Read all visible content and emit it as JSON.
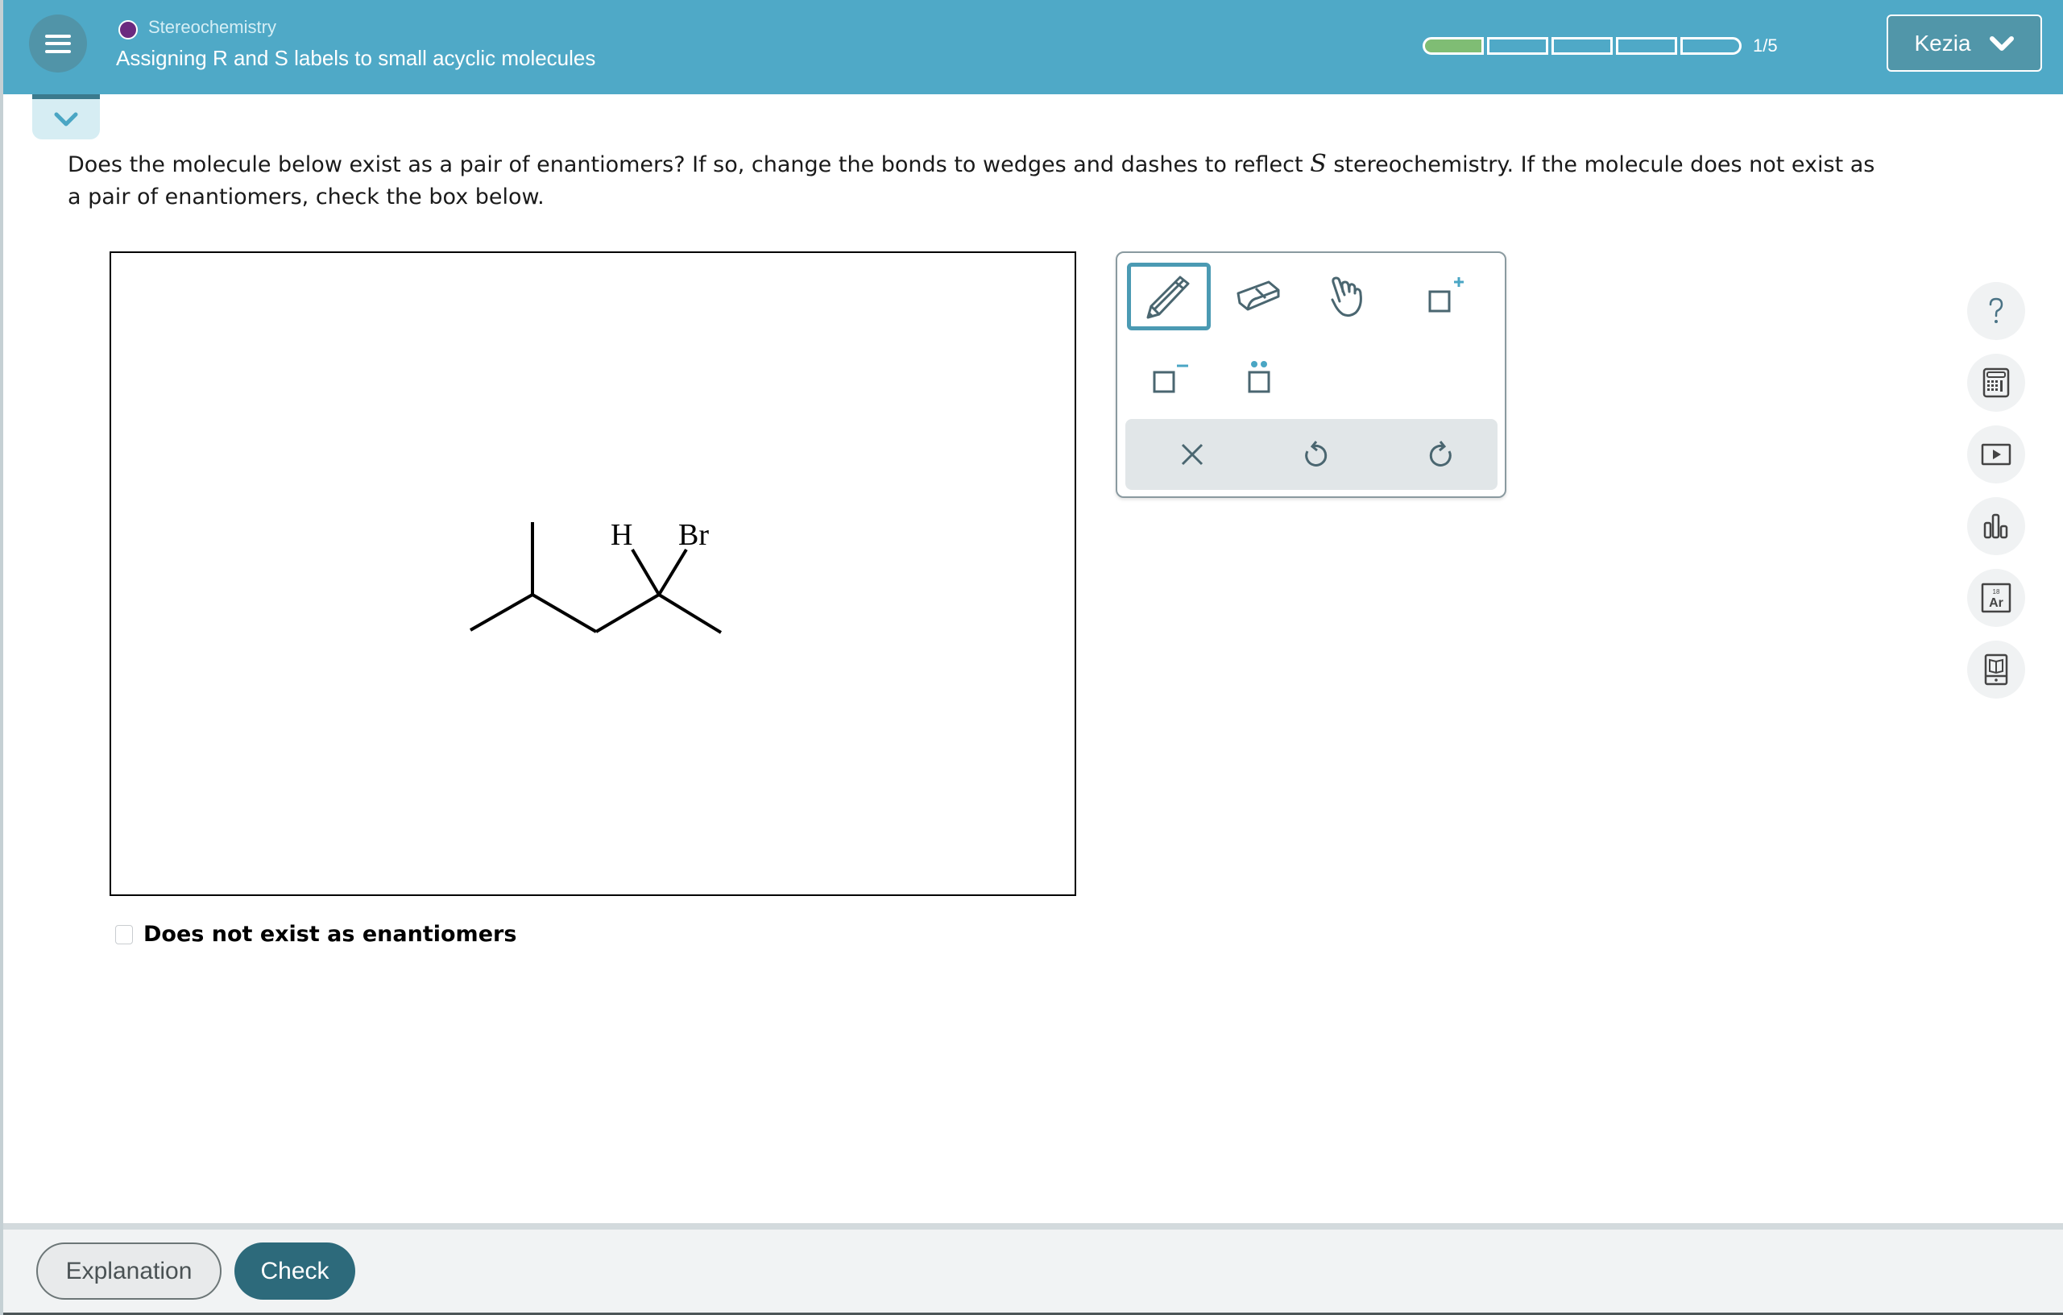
{
  "header": {
    "topic": "Stereochemistry",
    "topic_color": "#6b2a7f",
    "lesson_title": "Assigning R and S labels to small acyclic molecules",
    "progress": {
      "current": 1,
      "total": 5,
      "label": "1/5"
    },
    "user_name": "Kezia"
  },
  "question": {
    "text_before": "Does the molecule below exist as a pair of enantiomers? If so, change the bonds to wedges and dashes to reflect ",
    "math_symbol": "S",
    "text_after": " stereochemistry. If the molecule does not exist as a pair of enantiomers, check the box below."
  },
  "molecule": {
    "name": "2-bromo-4-methylpentane (skeletal)",
    "labels": {
      "h": "H",
      "br": "Br"
    }
  },
  "toolbar": {
    "tools": [
      {
        "name": "pencil",
        "icon": "pencil-icon",
        "selected": true
      },
      {
        "name": "eraser",
        "icon": "eraser-icon",
        "selected": false
      },
      {
        "name": "hand",
        "icon": "hand-icon",
        "selected": false
      },
      {
        "name": "add-positive-charge",
        "icon": "positive-charge-icon",
        "selected": false
      },
      {
        "name": "add-negative-charge",
        "icon": "negative-charge-icon",
        "selected": false
      },
      {
        "name": "add-lone-pair",
        "icon": "lone-pair-icon",
        "selected": false
      }
    ],
    "actions": [
      {
        "name": "clear",
        "icon": "close-icon"
      },
      {
        "name": "undo",
        "icon": "undo-icon"
      },
      {
        "name": "redo",
        "icon": "redo-icon"
      }
    ]
  },
  "side_tools": [
    {
      "name": "help",
      "icon": "question-icon"
    },
    {
      "name": "calculator",
      "icon": "calculator-icon"
    },
    {
      "name": "video",
      "icon": "play-icon"
    },
    {
      "name": "data",
      "icon": "bar-chart-icon"
    },
    {
      "name": "periodic-table",
      "icon": "periodic-table-icon",
      "text": "Ar",
      "number": "18"
    },
    {
      "name": "ebook",
      "icon": "ebook-icon"
    }
  ],
  "checkbox": {
    "label": "Does not exist as enantiomers",
    "checked": false
  },
  "footer": {
    "explanation_label": "Explanation",
    "check_label": "Check"
  },
  "colors": {
    "header_bg": "#4fa9c7",
    "accent": "#4b9ab3",
    "progress_done": "#7fbd74",
    "check_button": "#2d6a7b"
  }
}
